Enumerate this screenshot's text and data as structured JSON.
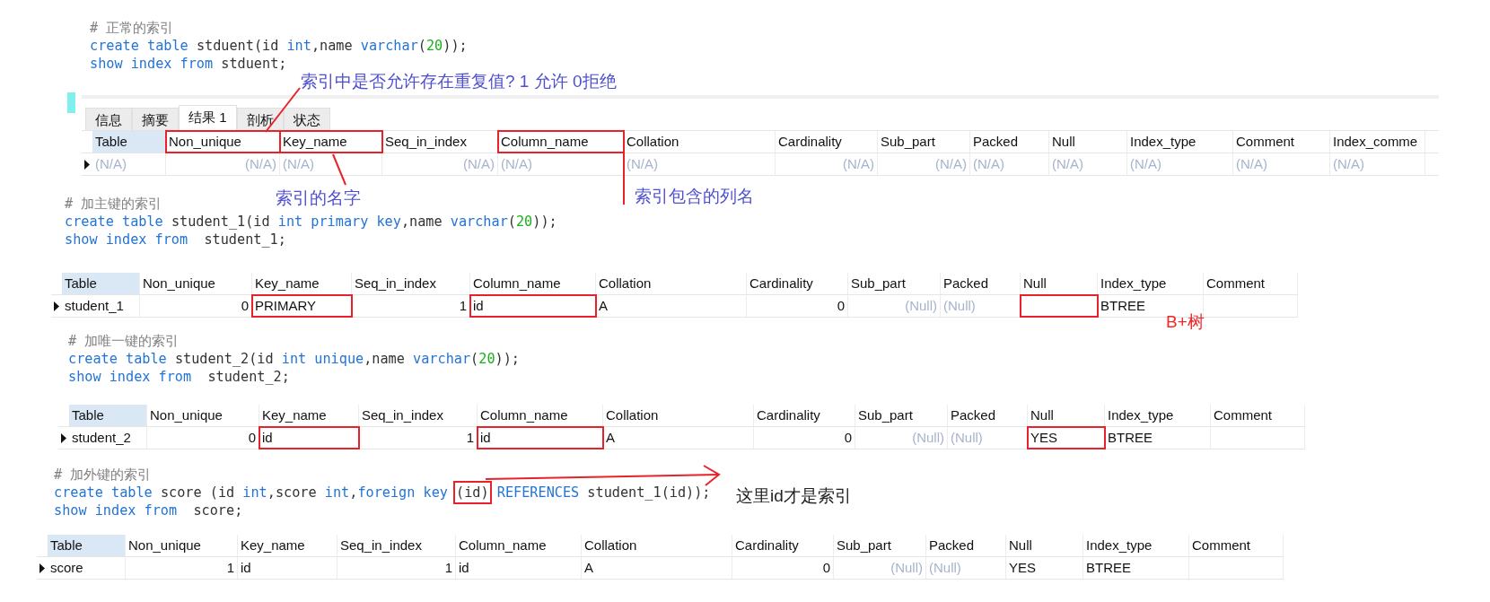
{
  "sections": [
    {
      "kind": "code",
      "lines": [
        [
          {
            "text": "# 正常的索引",
            "kind": "comment"
          }
        ],
        [
          {
            "text": "create table",
            "kind": "keyword"
          },
          {
            "text": " stduent(id ",
            "kind": "plain"
          },
          {
            "text": "int",
            "kind": "keyword"
          },
          {
            "text": ",name ",
            "kind": "plain"
          },
          {
            "text": "varchar",
            "kind": "keyword"
          },
          {
            "text": "(",
            "kind": "plain"
          },
          {
            "text": "20",
            "kind": "number"
          },
          {
            "text": "));",
            "kind": "plain"
          }
        ],
        [
          {
            "text": "show index from",
            "kind": "keyword"
          },
          {
            "text": " stduent;",
            "kind": "plain"
          }
        ]
      ]
    },
    {
      "kind": "result_panel",
      "tabs": [
        {
          "label": "信息",
          "selected": false
        },
        {
          "label": "摘要",
          "selected": false
        },
        {
          "label": "结果 1",
          "selected": true
        },
        {
          "label": "剖析",
          "selected": false
        },
        {
          "label": "状态",
          "selected": false
        }
      ],
      "table": {
        "columns": [
          {
            "label": "Table",
            "boxed": false
          },
          {
            "label": "Non_unique",
            "boxed": true
          },
          {
            "label": "Key_name",
            "boxed": true
          },
          {
            "label": "Seq_in_index",
            "boxed": false
          },
          {
            "label": "Column_name",
            "boxed": true
          },
          {
            "label": "Collation",
            "boxed": false
          },
          {
            "label": "Cardinality",
            "boxed": false
          },
          {
            "label": "Sub_part",
            "boxed": false
          },
          {
            "label": "Packed",
            "boxed": false
          },
          {
            "label": "Null",
            "boxed": false
          },
          {
            "label": "Index_type",
            "boxed": false
          },
          {
            "label": "Comment",
            "boxed": false
          },
          {
            "label": "Index_comme",
            "boxed": false
          }
        ],
        "rows": [
          {
            "cells": [
              {
                "text": "(N/A)",
                "null": true
              },
              {
                "text": "(N/A)",
                "null": true
              },
              {
                "text": "(N/A)",
                "null": true
              },
              {
                "text": "(N/A)",
                "null": true
              },
              {
                "text": "(N/A)",
                "null": true
              },
              {
                "text": "(N/A)",
                "null": true
              },
              {
                "text": "(N/A)",
                "null": true
              },
              {
                "text": "(N/A)",
                "null": true
              },
              {
                "text": "(N/A)",
                "null": true
              },
              {
                "text": "(N/A)",
                "null": true
              },
              {
                "text": "(N/A)",
                "null": true
              },
              {
                "text": "(N/A)",
                "null": true
              },
              {
                "text": "(N/A)",
                "null": true
              }
            ]
          }
        ]
      }
    },
    {
      "kind": "code",
      "lines": [
        [
          {
            "text": "# 加主键的索引",
            "kind": "comment"
          }
        ],
        [
          {
            "text": "create table",
            "kind": "keyword"
          },
          {
            "text": " student_1(id ",
            "kind": "plain"
          },
          {
            "text": "int primary key",
            "kind": "keyword"
          },
          {
            "text": ",name ",
            "kind": "plain"
          },
          {
            "text": "varchar",
            "kind": "keyword"
          },
          {
            "text": "(",
            "kind": "plain"
          },
          {
            "text": "20",
            "kind": "number"
          },
          {
            "text": "));",
            "kind": "plain"
          }
        ],
        [
          {
            "text": "show index from",
            "kind": "keyword"
          },
          {
            "text": "  student_1;",
            "kind": "plain"
          }
        ]
      ]
    },
    {
      "kind": "table",
      "columns": [
        {
          "label": "Table",
          "boxed": false
        },
        {
          "label": "Non_unique",
          "boxed": false
        },
        {
          "label": "Key_name",
          "boxed": false
        },
        {
          "label": "Seq_in_index",
          "boxed": false
        },
        {
          "label": "Column_name",
          "boxed": false
        },
        {
          "label": "Collation",
          "boxed": false
        },
        {
          "label": "Cardinality",
          "boxed": false
        },
        {
          "label": "Sub_part",
          "boxed": false
        },
        {
          "label": "Packed",
          "boxed": false
        },
        {
          "label": "Null",
          "boxed": false
        },
        {
          "label": "Index_type",
          "boxed": false
        },
        {
          "label": "Comment",
          "boxed": false
        }
      ],
      "rows": [
        {
          "cells": [
            {
              "text": "student_1"
            },
            {
              "text": "0"
            },
            {
              "text": "PRIMARY",
              "boxed": true
            },
            {
              "text": "1"
            },
            {
              "text": "id",
              "boxed": true
            },
            {
              "text": "A"
            },
            {
              "text": "0"
            },
            {
              "text": "(Null)",
              "null": true
            },
            {
              "text": "(Null)",
              "null": true
            },
            {
              "boxed": true
            },
            {
              "text": "BTREE"
            },
            {}
          ]
        }
      ]
    },
    {
      "kind": "code",
      "lines": [
        [
          {
            "text": "# 加唯一键的索引",
            "kind": "comment"
          }
        ],
        [
          {
            "text": "create table",
            "kind": "keyword"
          },
          {
            "text": " student_2(id ",
            "kind": "plain"
          },
          {
            "text": "int unique",
            "kind": "keyword"
          },
          {
            "text": ",name ",
            "kind": "plain"
          },
          {
            "text": "varchar",
            "kind": "keyword"
          },
          {
            "text": "(",
            "kind": "plain"
          },
          {
            "text": "20",
            "kind": "number"
          },
          {
            "text": "));",
            "kind": "plain"
          }
        ],
        [
          {
            "text": "show index from",
            "kind": "keyword"
          },
          {
            "text": "  student_2;",
            "kind": "plain"
          }
        ]
      ]
    },
    {
      "kind": "table",
      "columns": [
        {
          "label": "Table",
          "boxed": false
        },
        {
          "label": "Non_unique",
          "boxed": false
        },
        {
          "label": "Key_name",
          "boxed": false
        },
        {
          "label": "Seq_in_index",
          "boxed": false
        },
        {
          "label": "Column_name",
          "boxed": false
        },
        {
          "label": "Collation",
          "boxed": false
        },
        {
          "label": "Cardinality",
          "boxed": false
        },
        {
          "label": "Sub_part",
          "boxed": false
        },
        {
          "label": "Packed",
          "boxed": false
        },
        {
          "label": "Null",
          "boxed": false
        },
        {
          "label": "Index_type",
          "boxed": false
        },
        {
          "label": "Comment",
          "boxed": false
        }
      ],
      "rows": [
        {
          "cells": [
            {
              "text": "student_2"
            },
            {
              "text": "0"
            },
            {
              "text": "id",
              "boxed": true
            },
            {
              "text": "1"
            },
            {
              "text": "id",
              "boxed": true
            },
            {
              "text": "A"
            },
            {
              "text": "0"
            },
            {
              "text": "(Null)",
              "null": true
            },
            {
              "text": "(Null)",
              "null": true
            },
            {
              "text": "YES",
              "boxed": true
            },
            {
              "text": "BTREE"
            },
            {}
          ]
        }
      ]
    },
    {
      "kind": "code",
      "lines": [
        [
          {
            "text": "# 加外键的索引",
            "kind": "comment"
          }
        ],
        [
          {
            "text": "create table",
            "kind": "keyword"
          },
          {
            "text": " score (id ",
            "kind": "plain"
          },
          {
            "text": "int",
            "kind": "keyword"
          },
          {
            "text": ",score ",
            "kind": "plain"
          },
          {
            "text": "int",
            "kind": "keyword"
          },
          {
            "text": ",",
            "kind": "plain"
          },
          {
            "text": "foreign key",
            "kind": "keyword"
          },
          {
            "text": "(id)",
            "kind": "plain",
            "boxed": true
          },
          {
            "text": "REFERENCES",
            "kind": "keyword"
          },
          {
            "text": " student_1(id));",
            "kind": "plain"
          }
        ],
        [
          {
            "text": "show index from",
            "kind": "keyword"
          },
          {
            "text": "  score;",
            "kind": "plain"
          }
        ]
      ]
    },
    {
      "kind": "table",
      "columns": [
        {
          "label": "Table",
          "boxed": false
        },
        {
          "label": "Non_unique",
          "boxed": false
        },
        {
          "label": "Key_name",
          "boxed": false
        },
        {
          "label": "Seq_in_index",
          "boxed": false
        },
        {
          "label": "Column_name",
          "boxed": false
        },
        {
          "label": "Collation",
          "boxed": false
        },
        {
          "label": "Cardinality",
          "boxed": false
        },
        {
          "label": "Sub_part",
          "boxed": false
        },
        {
          "label": "Packed",
          "boxed": false
        },
        {
          "label": "Null",
          "boxed": false
        },
        {
          "label": "Index_type",
          "boxed": false
        },
        {
          "label": "Comment",
          "boxed": false
        }
      ],
      "rows": [
        {
          "cells": [
            {
              "text": "score"
            },
            {
              "text": "1"
            },
            {
              "text": "id"
            },
            {
              "text": "1"
            },
            {
              "text": "id"
            },
            {
              "text": "A"
            },
            {
              "text": "0"
            },
            {
              "text": "(Null)",
              "null": true
            },
            {
              "text": "(Null)",
              "null": true
            },
            {
              "text": "YES"
            },
            {
              "text": "BTREE"
            },
            {}
          ]
        }
      ]
    }
  ],
  "annotations": [
    {
      "text": "索引中是否允许存在重复值? 1 允许 0拒绝",
      "color": "#4f4fcf"
    },
    {
      "text": "索引的名字",
      "color": "#4f4fcf"
    },
    {
      "text": "索引包含的列名",
      "color": "#4f4fcf"
    },
    {
      "text": "B+树",
      "color": "#ee2a2a"
    },
    {
      "text": "这里id才是索引",
      "color": "#222222"
    }
  ]
}
